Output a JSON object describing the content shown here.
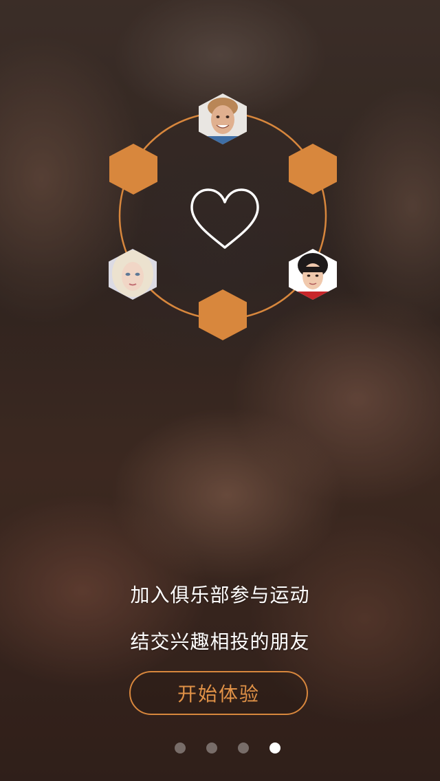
{
  "onboarding": {
    "tagline_line1": "加入俱乐部参与运动",
    "tagline_line2": "结交兴趣相投的朋友",
    "start_button_label": "开始体验"
  },
  "pagination": {
    "total_pages": 4,
    "current_page": 4
  },
  "colors": {
    "accent": "#d8873d",
    "text": "#ffffff",
    "dot_inactive": "rgba(255,255,255,0.35)",
    "dot_active": "#ffffff"
  },
  "icons": {
    "center": "heart-outline-icon",
    "avatars": [
      "avatar-man-smiling",
      "avatar-woman-blonde",
      "avatar-young-man"
    ]
  }
}
